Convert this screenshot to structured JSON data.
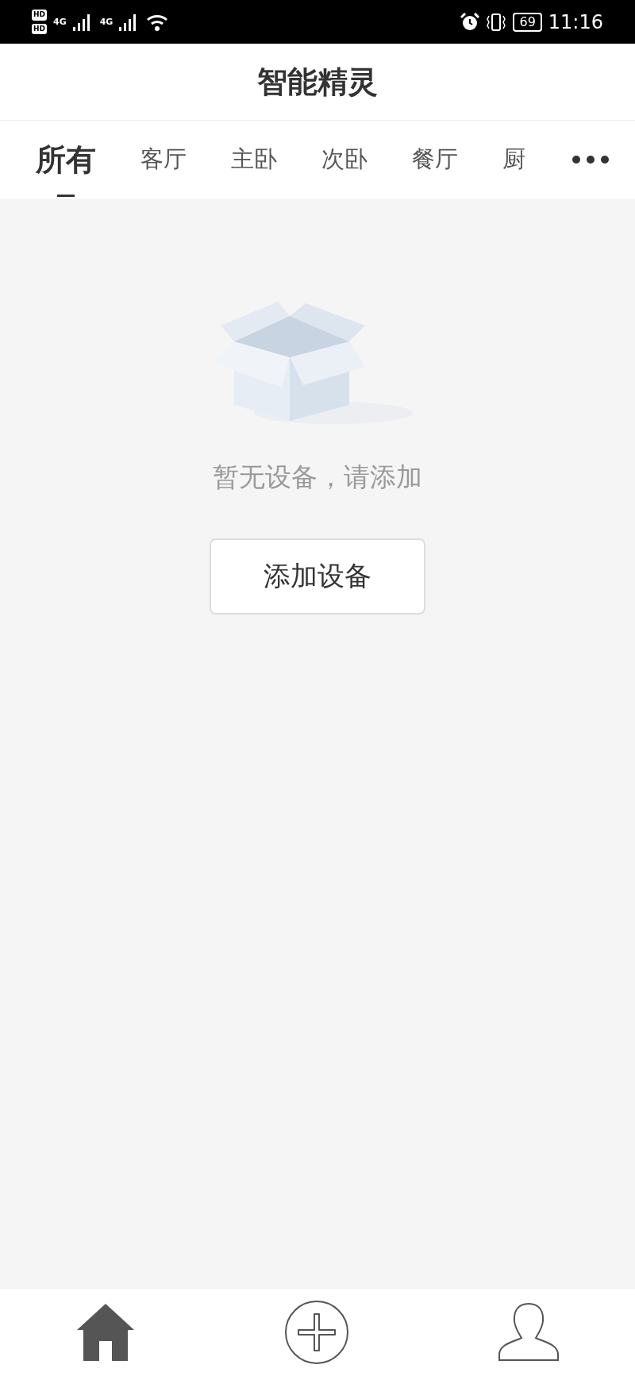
{
  "status_bar": {
    "sim_labels": [
      "HD",
      "HD"
    ],
    "network_labels": [
      "4G",
      "4G"
    ],
    "battery": "69",
    "time": "11:16"
  },
  "header": {
    "title": "智能精灵"
  },
  "tabs": [
    {
      "label": "所有",
      "selected": true
    },
    {
      "label": "客厅",
      "selected": false
    },
    {
      "label": "主卧",
      "selected": false
    },
    {
      "label": "次卧",
      "selected": false
    },
    {
      "label": "餐厅",
      "selected": false
    },
    {
      "label": "厨",
      "selected": false
    }
  ],
  "empty_state": {
    "message": "暂无设备，请添加",
    "button": "添加设备"
  },
  "bottom_nav": [
    {
      "kind": "home",
      "selected": true
    },
    {
      "kind": "add",
      "selected": false
    },
    {
      "kind": "profile",
      "selected": false
    }
  ]
}
